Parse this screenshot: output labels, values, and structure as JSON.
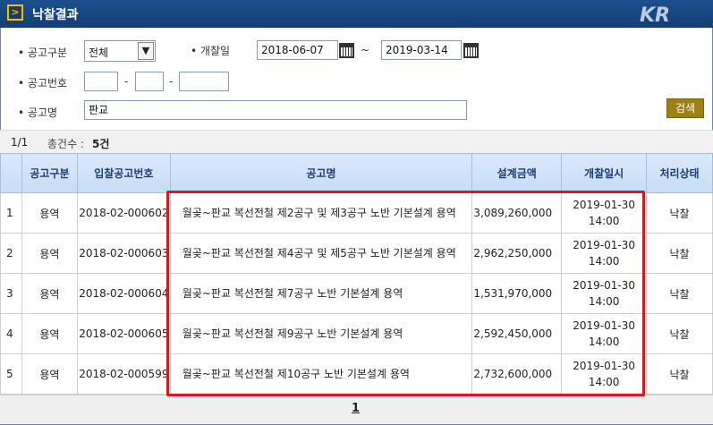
{
  "window": {
    "title": "낙찰결과",
    "title_icon": "chevron-right-icon",
    "logo": "KR"
  },
  "form": {
    "type_label": "공고구분",
    "type_value": "전체",
    "date_label": "개찰일",
    "date_from": "2018-06-07",
    "date_sep": "~",
    "date_to": "2019-03-14",
    "number_label": "공고번호",
    "number_sep1": "-",
    "number_sep2": "-",
    "name_label": "공고명",
    "name_value": "판교",
    "search_button": "검색"
  },
  "status": {
    "page": "1/1",
    "count_label": "총건수 :",
    "count": "5건"
  },
  "table": {
    "headers": [
      "공고구분",
      "입찰공고번호",
      "공고명",
      "설계금액",
      "개찰일시",
      "처리상태"
    ],
    "rows": [
      {
        "no": "1",
        "type": "용역",
        "id": "2018-02-000602",
        "name": "월곶~판교 복선전철 제2공구 및 제3공구 노반 기본설계 용역",
        "amount": "3,089,260,000",
        "date": "2019-01-30",
        "time": "14:00",
        "status": "낙찰"
      },
      {
        "no": "2",
        "type": "용역",
        "id": "2018-02-000603",
        "name": "월곶~판교 복선전철 제4공구 및 제5공구 노반 기본설계 용역",
        "amount": "2,962,250,000",
        "date": "2019-01-30",
        "time": "14:00",
        "status": "낙찰"
      },
      {
        "no": "3",
        "type": "용역",
        "id": "2018-02-000604",
        "name": "월곶~판교 복선전철 제7공구 노반 기본설계 용역",
        "amount": "1,531,970,000",
        "date": "2019-01-30",
        "time": "14:00",
        "status": "낙찰"
      },
      {
        "no": "4",
        "type": "용역",
        "id": "2018-02-000605",
        "name": "월곶~판교 복선전철 제9공구 노반 기본설계 용역",
        "amount": "2,592,450,000",
        "date": "2019-01-30",
        "time": "14:00",
        "status": "낙찰"
      },
      {
        "no": "5",
        "type": "용역",
        "id": "2018-02-000599",
        "name": "월곶~판교 복선전철 제10공구 노반 기본설계 용역",
        "amount": "2,732,600,000",
        "date": "2019-01-30",
        "time": "14:00",
        "status": "낙찰"
      }
    ]
  },
  "pager": {
    "current": "1"
  },
  "colors": {
    "title_bar": "#1c4f8d",
    "search_button": "#9f8014",
    "highlight": "#e8101c",
    "header_bg": "#c6dcf5"
  }
}
